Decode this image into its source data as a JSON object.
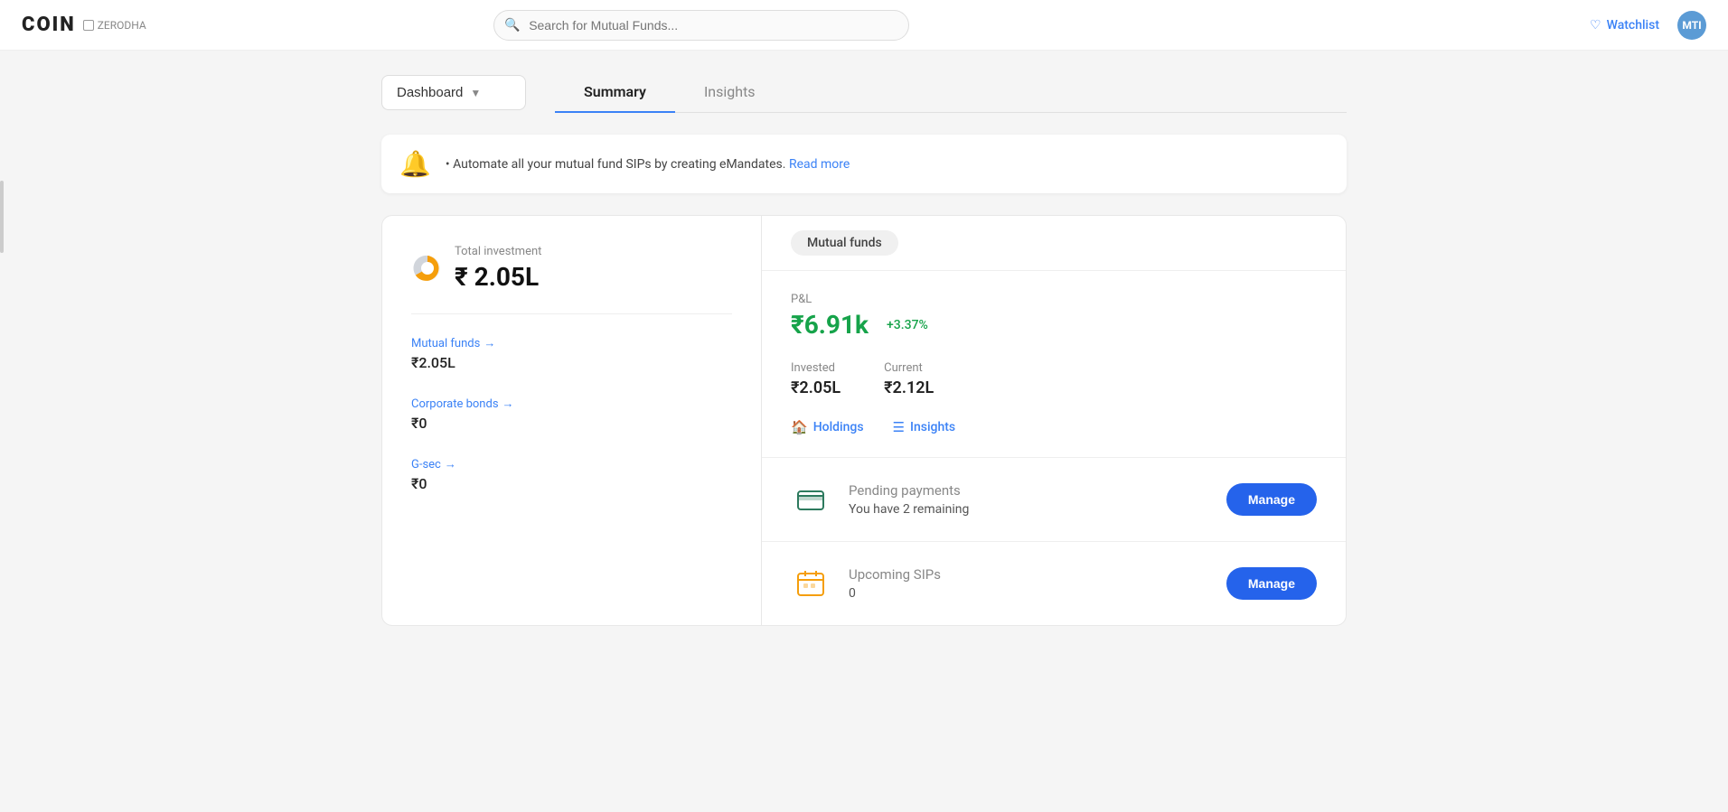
{
  "app": {
    "name": "COIN",
    "brand": "ZERODHA"
  },
  "search": {
    "placeholder": "Search for Mutual Funds..."
  },
  "nav": {
    "watchlist_label": "Watchlist",
    "avatar_text": "MTI"
  },
  "header": {
    "dashboard_label": "Dashboard",
    "tabs": [
      {
        "id": "summary",
        "label": "Summary",
        "active": true
      },
      {
        "id": "insights",
        "label": "Insights",
        "active": false
      }
    ]
  },
  "notification": {
    "text": "Automate all your mutual fund SIPs by creating eMandates.",
    "link_text": "Read more"
  },
  "left_panel": {
    "total_investment_label": "Total investment",
    "total_amount": "₹ 2.05L",
    "items": [
      {
        "id": "mutual-funds",
        "label": "Mutual funds",
        "value": "₹2.05L",
        "has_link": true
      },
      {
        "id": "corporate-bonds",
        "label": "Corporate bonds",
        "value": "₹0",
        "has_link": true
      },
      {
        "id": "g-sec",
        "label": "G-sec",
        "value": "₹0",
        "has_link": true
      }
    ]
  },
  "right_panel": {
    "mutual_funds_badge": "Mutual funds",
    "pl_label": "P&L",
    "pl_value": "₹6.91k",
    "pl_percent": "+3.37%",
    "invested_label": "Invested",
    "invested_value": "₹2.05L",
    "current_label": "Current",
    "current_value": "₹2.12L",
    "holdings_label": "Holdings",
    "insights_label": "Insights",
    "pending_payments": {
      "title": "Pending payments",
      "subtitle": "You have 2 remaining",
      "btn_label": "Manage"
    },
    "upcoming_sips": {
      "title": "Upcoming SIPs",
      "subtitle": "0",
      "btn_label": "Manage"
    }
  }
}
